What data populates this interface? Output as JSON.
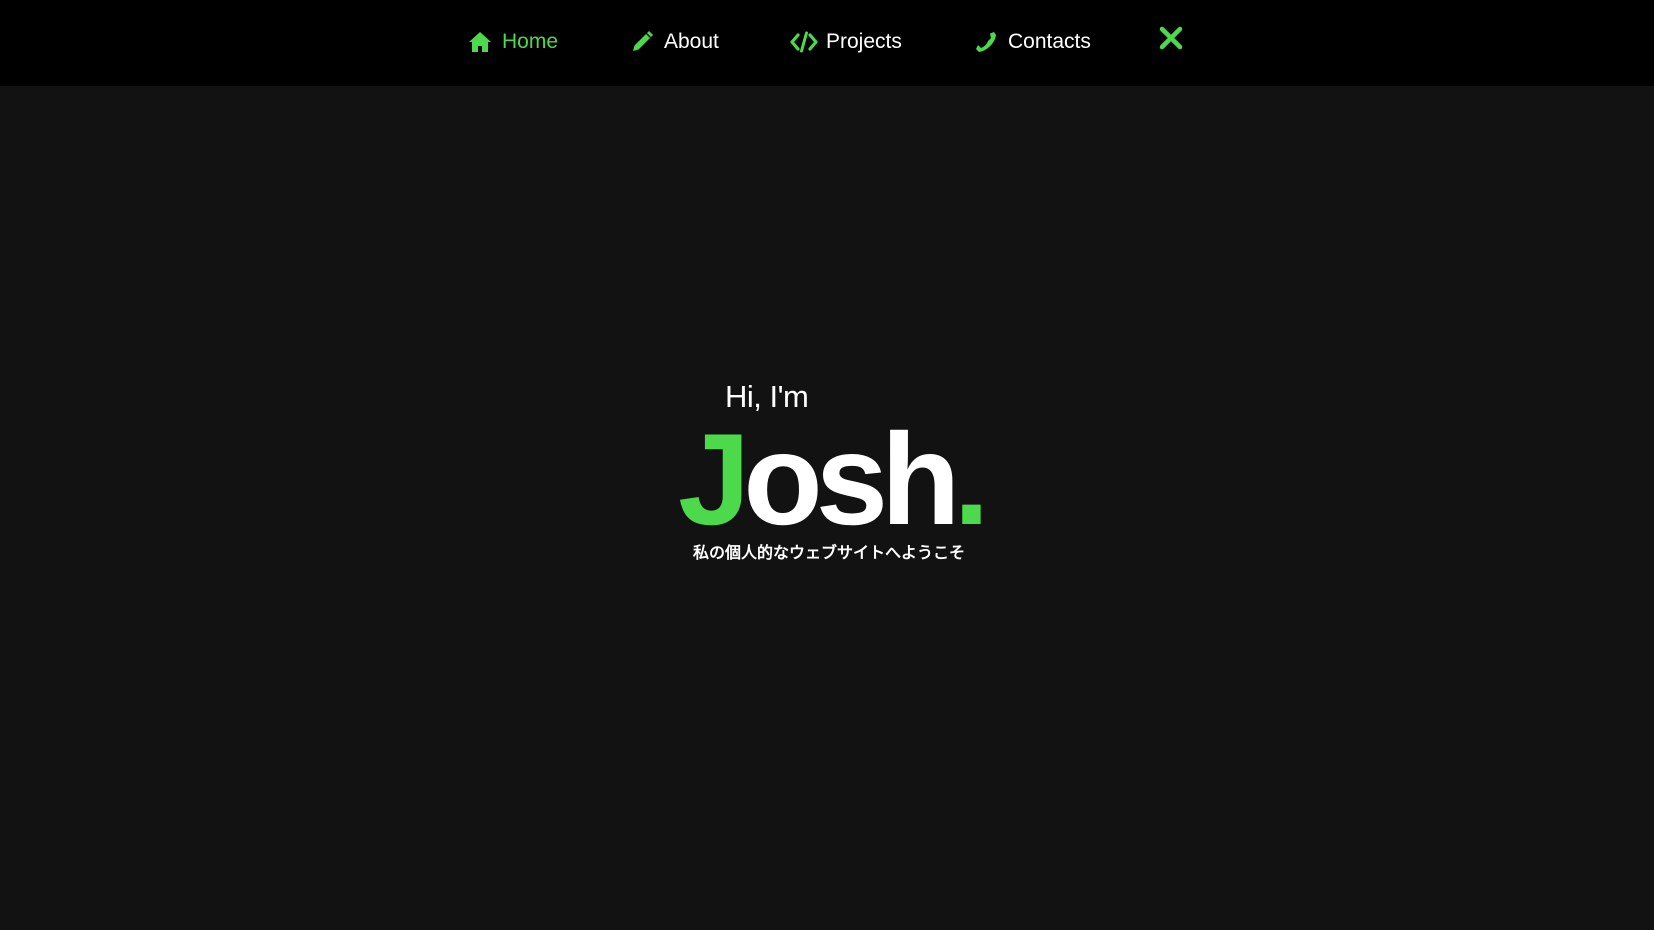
{
  "colors": {
    "accent": "#4cd94c",
    "nav_background": "#000000",
    "page_background": "#121212",
    "text": "#ffffff"
  },
  "nav": {
    "items": [
      {
        "label": "Home",
        "icon": "home-icon",
        "active": true
      },
      {
        "label": "About",
        "icon": "pencil-icon",
        "active": false
      },
      {
        "label": "Projects",
        "icon": "code-icon",
        "active": false
      },
      {
        "label": "Contacts",
        "icon": "phone-icon",
        "active": false
      }
    ],
    "close_icon": "close-icon"
  },
  "hero": {
    "greeting": "Hi, I'm",
    "name_first_letter": "J",
    "name_rest": "osh",
    "name_dot": ".",
    "tagline": "私の個人的なウェブサイトへようこそ"
  }
}
